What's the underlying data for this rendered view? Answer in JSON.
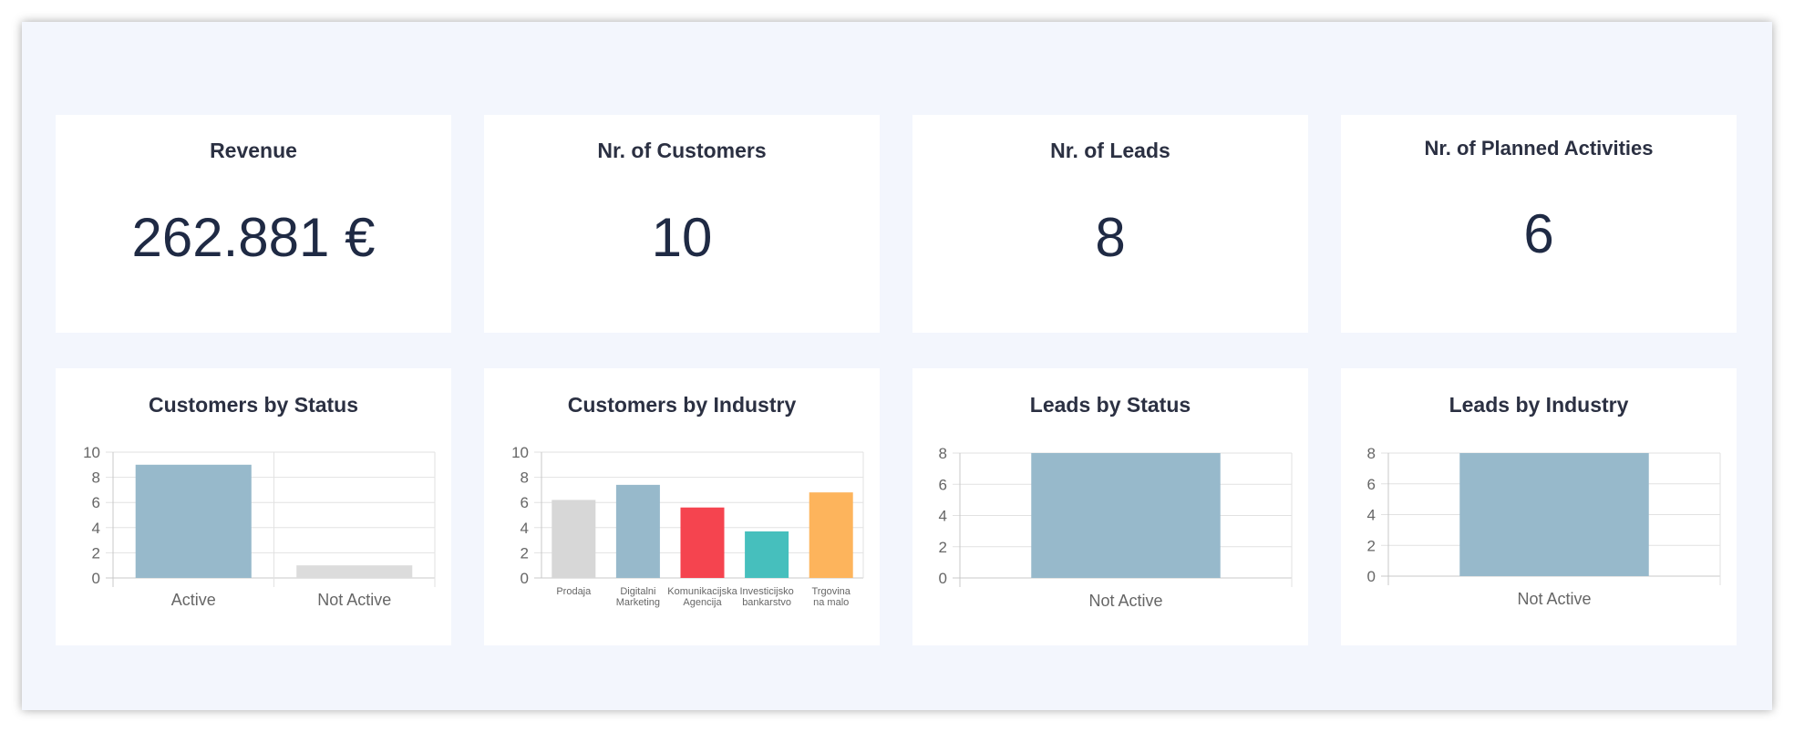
{
  "stats": [
    {
      "title": "Revenue",
      "value": "262.881 €"
    },
    {
      "title": "Nr. of Customers",
      "value": "10"
    },
    {
      "title": "Nr. of Leads",
      "value": "8"
    },
    {
      "title": "Nr. of Planned Activities",
      "value": "6"
    }
  ],
  "charts": [
    {
      "title": "Customers by Status"
    },
    {
      "title": "Customers by Industry"
    },
    {
      "title": "Leads by Status"
    },
    {
      "title": "Leads by Industry"
    }
  ],
  "chart_data": [
    {
      "type": "bar",
      "title": "Customers by Status",
      "categories": [
        "Active",
        "Not Active"
      ],
      "values": [
        9,
        1
      ],
      "colors": [
        "#97b9cb",
        "#dcdcdc"
      ],
      "ylim": [
        0,
        10
      ],
      "yticks": [
        0,
        2,
        4,
        6,
        8,
        10
      ],
      "grid": true
    },
    {
      "type": "bar",
      "title": "Customers by Industry",
      "categories": [
        [
          "Prodaja"
        ],
        [
          "Digitalni",
          "Marketing"
        ],
        [
          "Komunikacijska",
          "Agencija"
        ],
        [
          "Investicijsko",
          "bankarstvo"
        ],
        [
          "Trgovina",
          "na malo"
        ]
      ],
      "values": [
        6.2,
        7.4,
        5.6,
        3.7,
        6.8
      ],
      "colors": [
        "#d7d7d7",
        "#97b9cb",
        "#f5444f",
        "#46bfbd",
        "#fdb45c"
      ],
      "ylim": [
        0,
        10
      ],
      "yticks": [
        0,
        2,
        4,
        6,
        8,
        10
      ],
      "grid": true
    },
    {
      "type": "bar",
      "title": "Leads by Status",
      "categories": [
        "Not Active"
      ],
      "values": [
        8
      ],
      "colors": [
        "#97b9cb"
      ],
      "ylim": [
        0,
        8
      ],
      "yticks": [
        0,
        2,
        4,
        6,
        8
      ],
      "grid": true
    },
    {
      "type": "bar",
      "title": "Leads by Industry",
      "categories": [
        "Not Active"
      ],
      "values": [
        8
      ],
      "colors": [
        "#97b9cb"
      ],
      "ylim": [
        0,
        8
      ],
      "yticks": [
        0,
        2,
        4,
        6,
        8
      ],
      "grid": true
    }
  ]
}
